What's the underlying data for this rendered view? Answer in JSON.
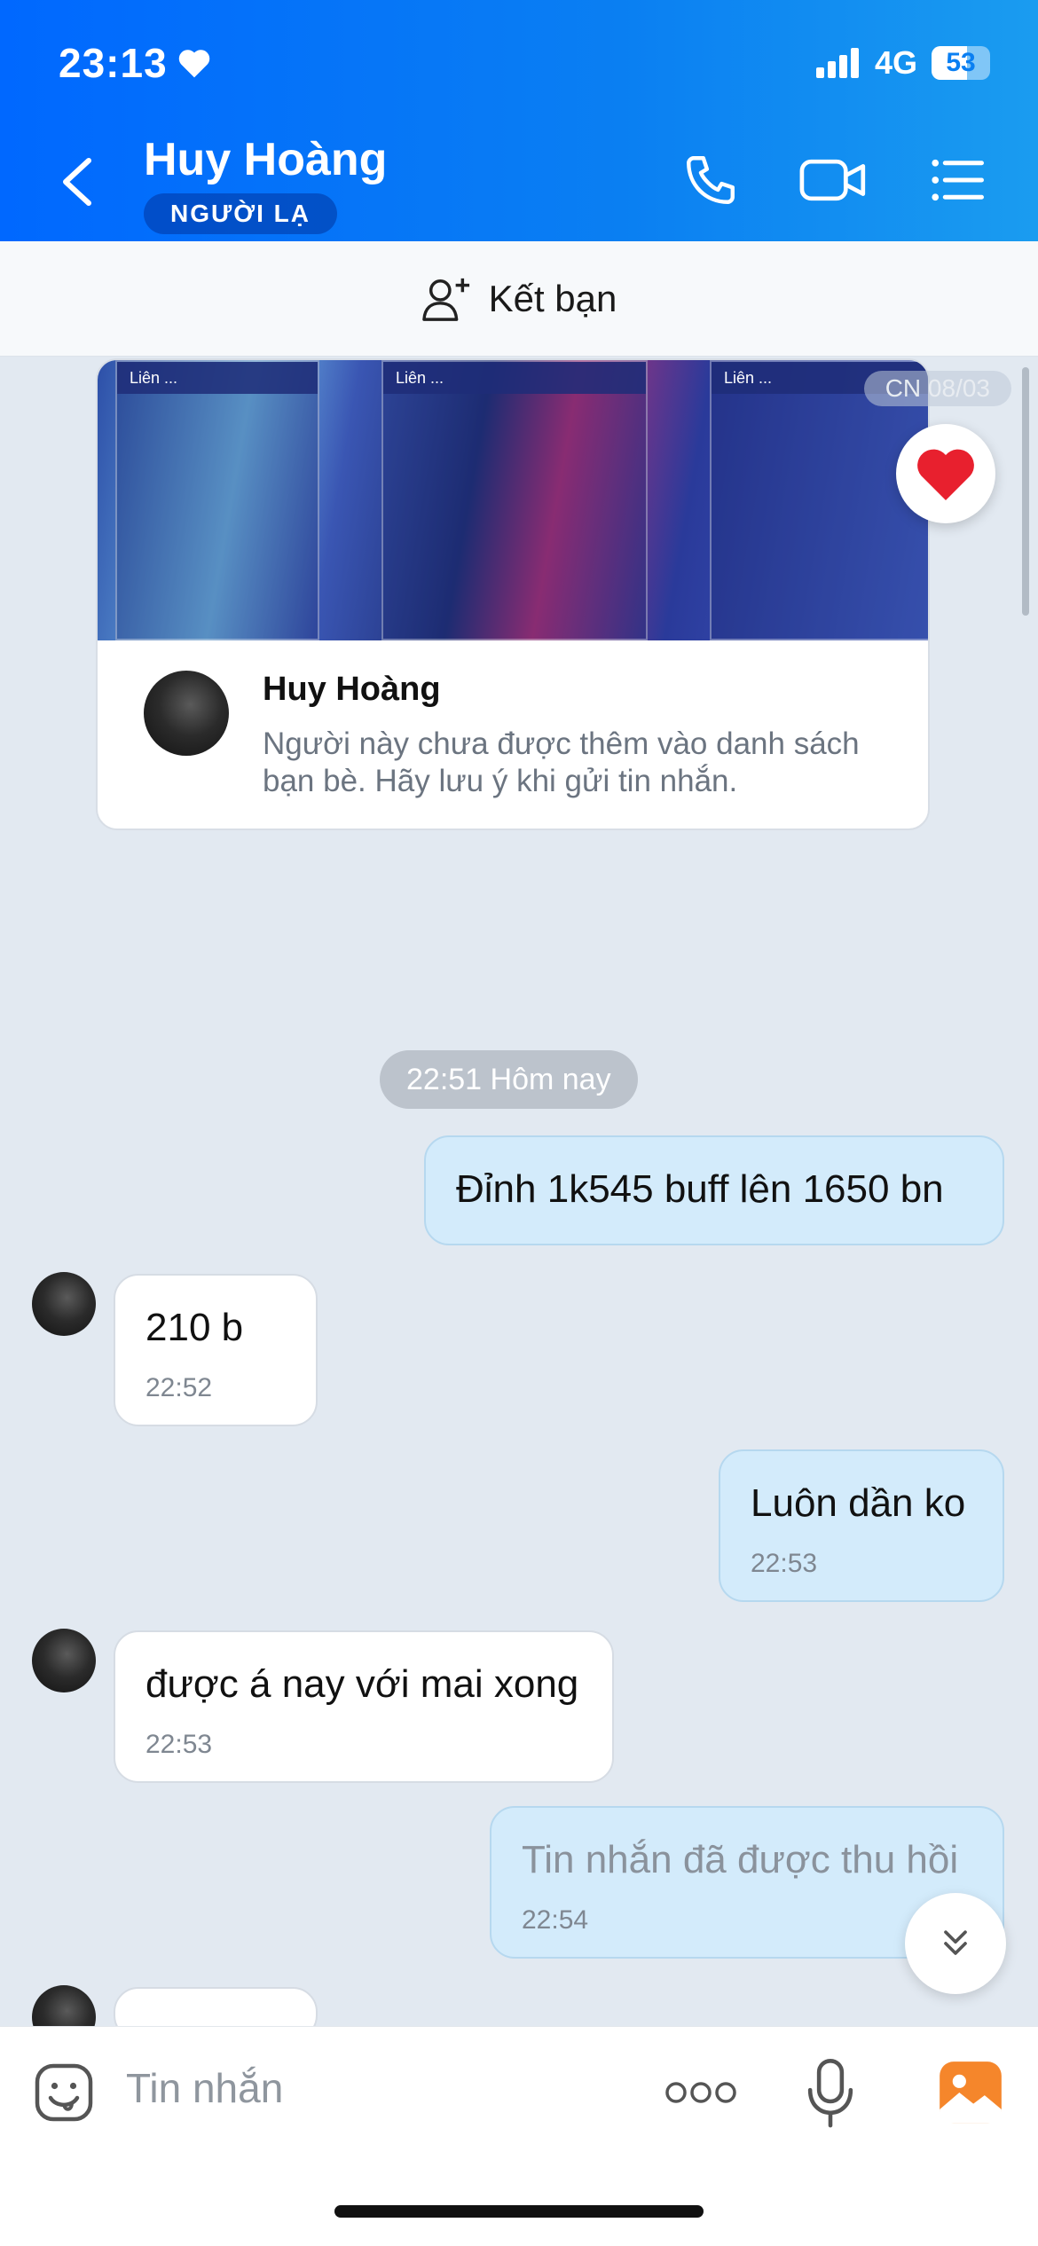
{
  "status_bar": {
    "time": "23:13",
    "network": "4G",
    "battery": "53"
  },
  "header": {
    "contact_name": "Huy Hoàng",
    "badge": "NGƯỜI LẠ"
  },
  "friend_bar": {
    "label": "Kết bạn"
  },
  "card": {
    "name": "Huy Hoàng",
    "description": "Người này chưa được thêm vào danh sách bạn bè. Hãy lưu ý khi gửi tin nhắn.",
    "date_marker": "CN 08/03"
  },
  "time_separator": "22:51 Hôm nay",
  "messages": [
    {
      "direction": "out",
      "text": "Đỉnh 1k545 buff lên 1650 bn",
      "time": ""
    },
    {
      "direction": "in",
      "text": "210 b",
      "time": "22:52"
    },
    {
      "direction": "out",
      "text": "Luôn dần ko",
      "time": "22:53"
    },
    {
      "direction": "in",
      "text": "được á nay với mai xong",
      "time": "22:53"
    },
    {
      "direction": "out",
      "text": "Tin nhắn đã được thu hồi",
      "time": "22:54"
    },
    {
      "direction": "in",
      "text": "...",
      "time": ""
    }
  ],
  "composer": {
    "placeholder": "Tin nhắn"
  }
}
